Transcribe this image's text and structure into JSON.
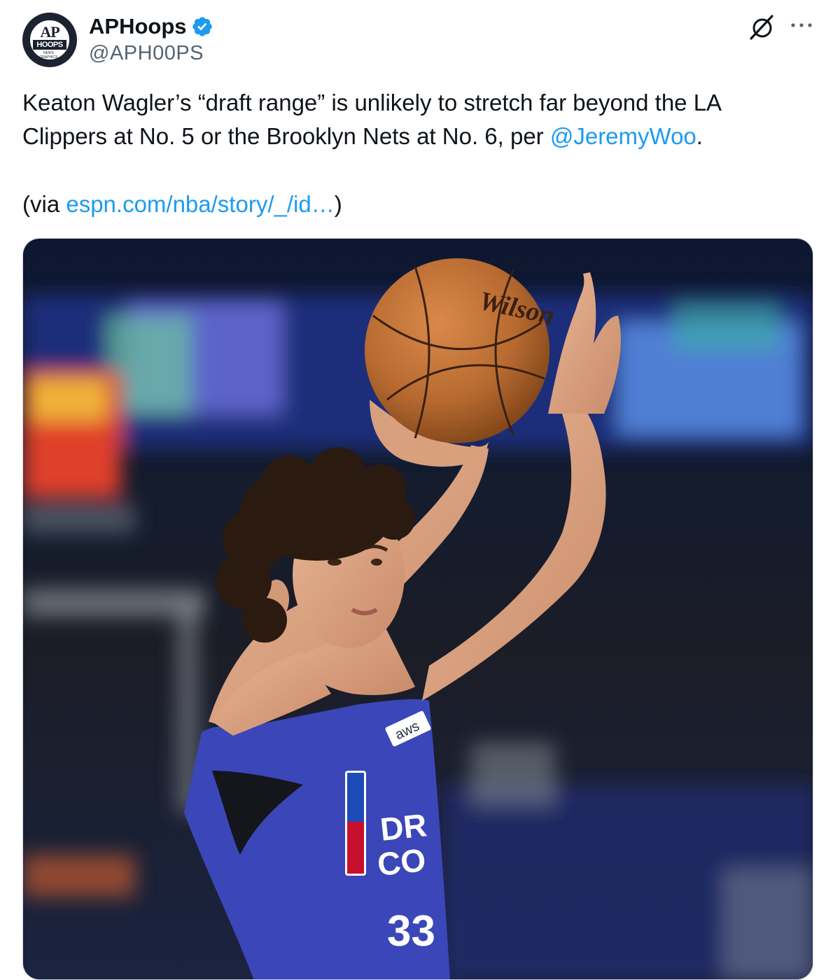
{
  "author": {
    "display_name": "APHoops",
    "handle": "@APH00PS",
    "avatar": {
      "line1": "AP",
      "line2": "HOOPS",
      "tagline": "NEWS · GRAPHICS · STATS"
    },
    "verified_icon": "verified-badge-icon"
  },
  "actions": {
    "grok_icon": "grok-icon",
    "more_icon": "more-icon"
  },
  "tweet": {
    "line1": "Keaton Wagler’s “draft range” is unlikely to stretch far beyond the LA",
    "line2_text": "Clippers at No. 5 or the Brooklyn Nets at No. 6, per ",
    "mention": "@JeremyWoo",
    "line2_end": ".",
    "via_open": "(via ",
    "via_link": "espn.com/nba/story/_/id…",
    "via_close": ")"
  },
  "media": {
    "jersey_number": "33",
    "sponsor": "aws",
    "ball_brand": "Wilson"
  },
  "colors": {
    "link": "#1d9bf0",
    "text": "#0f1419",
    "secondary": "#536471",
    "jersey": "#3b46b8"
  }
}
